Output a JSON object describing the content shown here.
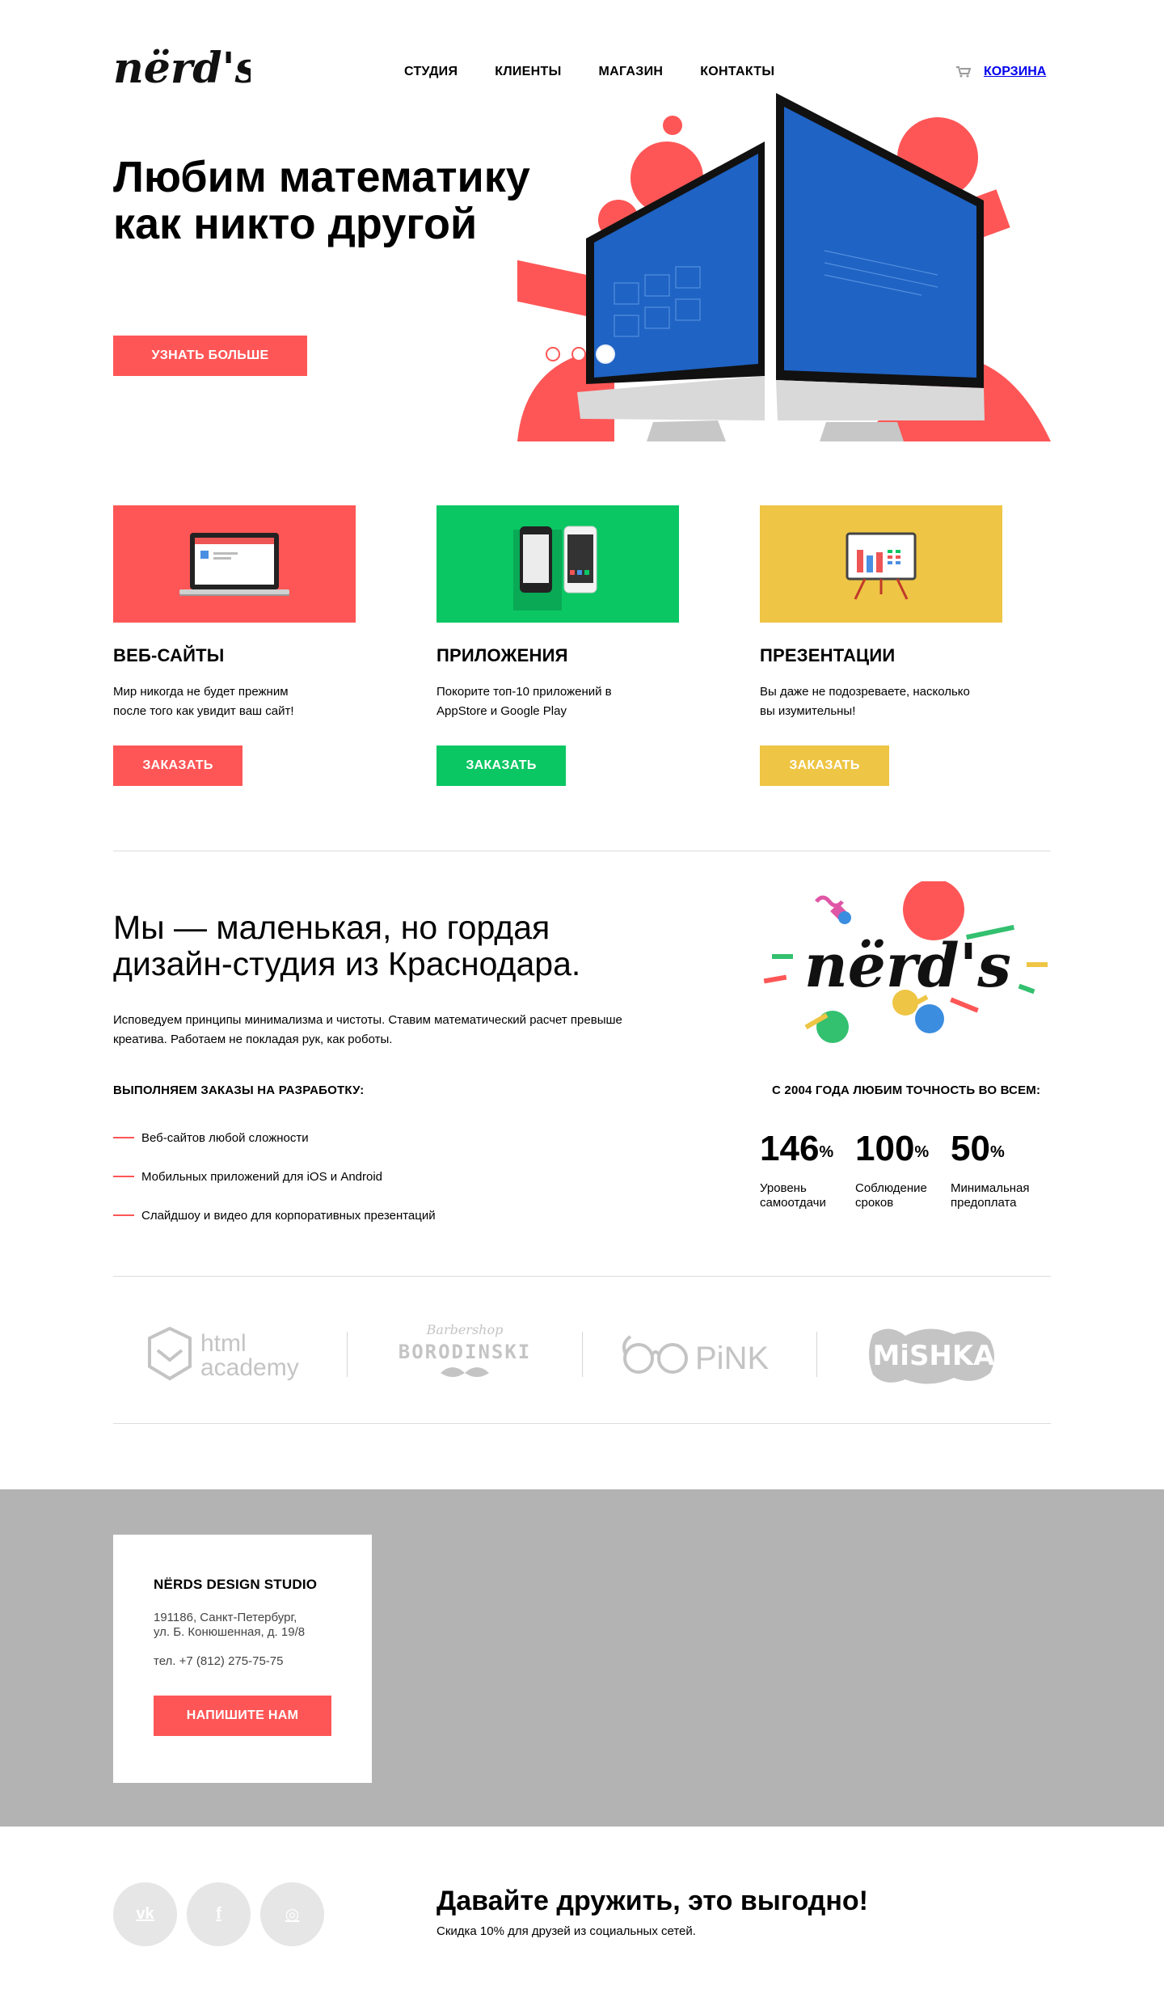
{
  "brand": {
    "logo_text": "nërd's"
  },
  "nav": {
    "items": [
      "СТУДИЯ",
      "КЛИЕНТЫ",
      "МАГАЗИН",
      "КОНТАКТЫ"
    ],
    "cart_label": "КОРЗИНА",
    "cart_icon": "cart-icon"
  },
  "hero": {
    "title_line1": "Любим математику",
    "title_line2": "как никто другой",
    "button_label": "УЗНАТЬ БОЛЬШЕ",
    "slides": 3,
    "active_slide": 3
  },
  "services": [
    {
      "title": "ВЕБ-САЙТЫ",
      "text": "Мир никогда не будет прежним после того как увидит ваш сайт!",
      "button_label": "ЗАКАЗАТЬ",
      "color": "#fe5656",
      "icon": "laptop-icon"
    },
    {
      "title": "ПРИЛОЖЕНИЯ",
      "text": "Покорите топ-10 приложений в AppStore и Google Play",
      "button_label": "ЗАКАЗАТЬ",
      "color": "#0ac763",
      "icon": "phones-icon"
    },
    {
      "title": "ПРЕЗЕНТАЦИИ",
      "text": "Вы даже не подозреваете, насколько вы изумительны!",
      "button_label": "ЗАКАЗАТЬ",
      "color": "#eec544",
      "icon": "presentation-board-icon"
    }
  ],
  "about": {
    "title_line1": "Мы — маленькая, но гордая",
    "title_line2": "дизайн-студия из Краснодара.",
    "text": "Исповедуем принципы минимализма и чистоты. Ставим математический расчет превыше креатива. Работаем не покладая рук, как роботы.",
    "list_heading": "ВЫПОЛНЯЕМ ЗАКАЗЫ НА РАЗРАБОТКУ:",
    "list": [
      "Веб-сайтов любой сложности",
      "Мобильных приложений для iOS и Android",
      "Слайдшоу и видео для корпоративных презентаций"
    ],
    "stats_heading": "С 2004 ГОДА ЛЮБИМ ТОЧНОСТЬ ВО ВСЕМ:",
    "stats": [
      {
        "value": "146",
        "unit": "%",
        "label_line1": "Уровень",
        "label_line2": "самоотдачи"
      },
      {
        "value": "100",
        "unit": "%",
        "label_line1": "Соблюдение",
        "label_line2": "сроков"
      },
      {
        "value": "50",
        "unit": "%",
        "label_line1": "Минимальная",
        "label_line2": "предоплата"
      }
    ]
  },
  "partners": [
    {
      "line1": "html",
      "line2": "academy"
    },
    {
      "line1": "Barbershop",
      "line2": "BORODINSKI"
    },
    {
      "line1": "PiNK"
    },
    {
      "line1": "MiSHKA"
    }
  ],
  "contacts": {
    "studio": "NЁRDS DESIGN STUDIO",
    "address_line1": "191186, Санкт-Петербург,",
    "address_line2": "ул. Б. Конюшенная, д. 19/8",
    "phone": "тел. +7 (812) 275-75-75",
    "button_label": "НАПИШИТЕ НАМ"
  },
  "footer": {
    "socials": [
      {
        "icon": "vk-icon",
        "glyph": "vk"
      },
      {
        "icon": "facebook-icon",
        "glyph": "f"
      },
      {
        "icon": "instagram-icon",
        "glyph": "◎"
      }
    ],
    "title": "Давайте дружить, это выгодно!",
    "subtitle": "Скидка 10% для друзей из социальных сетей."
  },
  "colors": {
    "red": "#fe5656",
    "green": "#0ac763",
    "yellow": "#eec544",
    "gray": "#b3b3b3"
  }
}
